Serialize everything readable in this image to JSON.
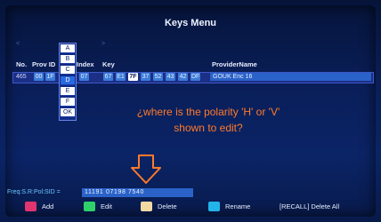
{
  "menu": {
    "title": "Keys Menu"
  },
  "nav": {
    "left": "<",
    "letter": "B",
    "right": ">"
  },
  "columns": {
    "no": "No.",
    "prov_id": "Prov ID",
    "index": "Index",
    "key": "Key",
    "provider": "ProviderName"
  },
  "row": {
    "no": "465",
    "prov_id_parts": [
      "00",
      "1F"
    ],
    "index": "07",
    "keys": [
      "67",
      "E1",
      "7F",
      "37",
      "52",
      "43",
      "42",
      "DF"
    ],
    "active_key_index": 2,
    "provider": "GOUK Enc 16"
  },
  "hex_popup": {
    "items": [
      "A",
      "B",
      "C",
      "D",
      "E",
      "F",
      "OK"
    ],
    "highlighted": "D"
  },
  "annotation": {
    "question_line1": "¿where is the polarity 'H' or 'V'",
    "question_line2": "shown to edit?"
  },
  "status": {
    "label": "Freq:S.R:Pol:SID =",
    "value": "11191  07198  7540"
  },
  "footer": {
    "add": {
      "label": "Add",
      "color": "#e0356f"
    },
    "edit": {
      "label": "Edit",
      "color": "#2fd06a"
    },
    "delete": {
      "label": "Delete",
      "color": "#f2d9a2"
    },
    "rename": {
      "label": "Rename",
      "color": "#22b4e8"
    },
    "recall": "[RECALL]  Delete All"
  },
  "colors": {
    "annotation": "#ff7a2a",
    "accent": "#2a62c8"
  }
}
